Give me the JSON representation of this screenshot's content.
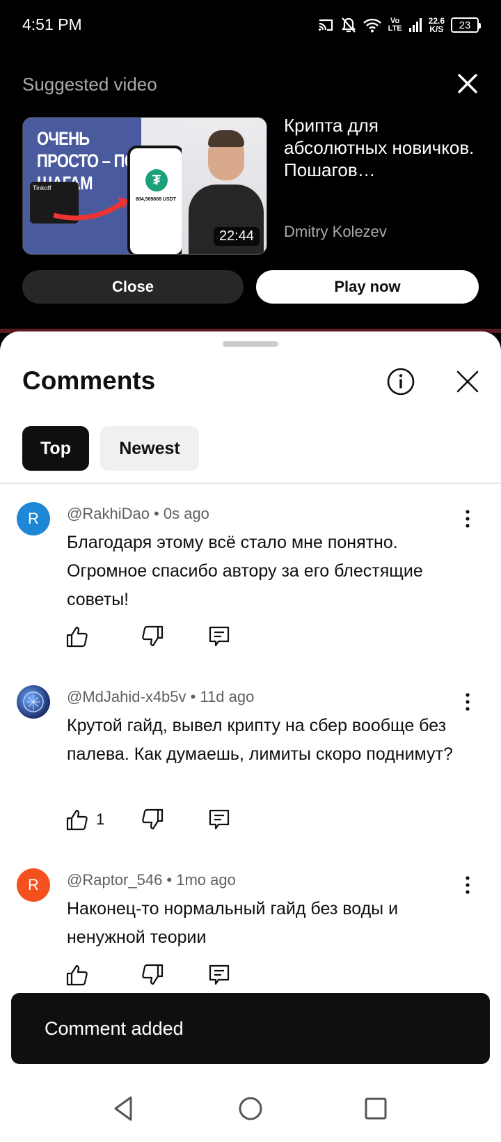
{
  "status_bar": {
    "time": "4:51 PM",
    "network_label": "Vo LTE",
    "speed_value": "22.6",
    "speed_unit": "K/S",
    "battery": "23"
  },
  "suggested": {
    "heading": "Suggested video",
    "thumbnail_text": "ОЧЕНЬ ПРОСТО – ПО ШАГАМ",
    "thumbnail_card_text": "Tinkoff",
    "thumbnail_amount": "804,569808 USDT",
    "duration": "22:44",
    "title": "Крипта для абсолютных новичков. Пошагов…",
    "channel": "Dmitry Kolezev",
    "close_label": "Close",
    "play_label": "Play now"
  },
  "comments_panel": {
    "title": "Comments",
    "sort_chips": [
      "Top",
      "Newest"
    ],
    "active_chip": "Top"
  },
  "comments": [
    {
      "avatar_letter": "R",
      "avatar_color": "#1e88d6",
      "author": "@RakhiDao",
      "time": "0s ago",
      "meta": "@RakhiDao • 0s ago",
      "text": "Благодаря этому всё стало мне понятно. Огромное спасибо автору за его блестящие советы!",
      "likes": ""
    },
    {
      "avatar_letter": "",
      "avatar_color": "#2a4d8f",
      "author": "@MdJahid-x4b5v",
      "time": "11d ago",
      "meta": "@MdJahid-x4b5v • 11d ago",
      "text": "Крутой гайд, вывел крипту на сбер вообще без палева. Как думаешь, лимиты скоро поднимут?",
      "likes": "1"
    },
    {
      "avatar_letter": "R",
      "avatar_color": "#f4511e",
      "author": "@Raptor_546",
      "time": "1mo ago",
      "meta": "@Raptor_546 • 1mo ago",
      "text": "Наконец-то нормальный гайд без воды и ненужной теории",
      "likes": ""
    }
  ],
  "snackbar": {
    "message": "Comment added"
  },
  "icons": {
    "cast": "cast-icon",
    "mute": "notifications-off-icon",
    "wifi": "wifi-icon",
    "signal": "signal-icon",
    "close": "close-icon",
    "info": "info-icon",
    "like": "thumbs-up-icon",
    "dislike": "thumbs-down-icon",
    "reply": "reply-icon",
    "more": "more-vert-icon",
    "back": "back-icon",
    "home": "home-icon",
    "recents": "recents-icon"
  }
}
